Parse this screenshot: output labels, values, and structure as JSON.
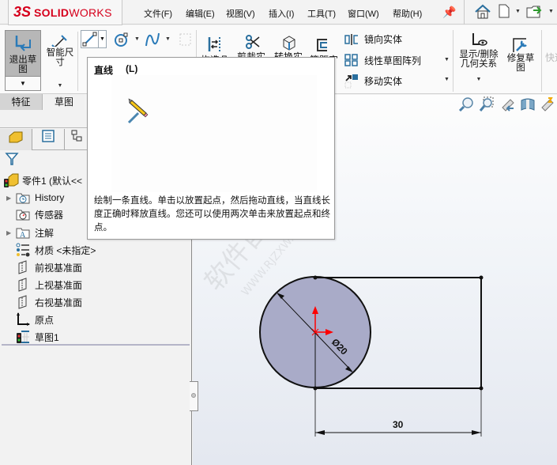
{
  "app": {
    "brand_prefix": "3S",
    "brand_bold": "SOLID",
    "brand_light": "WORKS"
  },
  "menu": [
    "文件(F)",
    "编辑(E)",
    "视图(V)",
    "插入(I)",
    "工具(T)",
    "窗口(W)",
    "帮助(H)"
  ],
  "title_icons": [
    "pin-icon",
    "home-icon",
    "new-document-icon",
    "open-document-icon"
  ],
  "ribbon": {
    "exit_sketch": "退出草图",
    "smart_dimension": "智能尺寸",
    "partial_labels": [
      "构造几",
      "剪裁实",
      "转换实",
      "等距实"
    ],
    "entity_tools": [
      "镜向实体",
      "线性草图阵列",
      "移动实体"
    ],
    "display_relations": "显示/删除几何关系",
    "repair_sketch": "修复草图",
    "quick_snaps_partial": "快速"
  },
  "command_tabs": {
    "feature": "特征",
    "sketch": "草图",
    "active": "草图"
  },
  "tooltip": {
    "title": "直线",
    "shortcut": "(L)",
    "description": "绘制一条直线。单击以放置起点，然后拖动直线，当直线长度正确时释放直线。您还可以使用两次单击来放置起点和终点。"
  },
  "feature_tree": {
    "root": "零件1  (默认<<",
    "items": [
      {
        "label": "History",
        "icon": "history-folder-icon",
        "expandable": true
      },
      {
        "label": "传感器",
        "icon": "sensor-folder-icon",
        "expandable": false
      },
      {
        "label": "注解",
        "icon": "annotation-folder-icon",
        "expandable": true
      },
      {
        "label": "材质 <未指定>",
        "icon": "material-icon",
        "expandable": false
      },
      {
        "label": "前视基准面",
        "icon": "plane-icon",
        "expandable": false
      },
      {
        "label": "上视基准面",
        "icon": "plane-icon",
        "expandable": false
      },
      {
        "label": "右视基准面",
        "icon": "plane-icon",
        "expandable": false
      },
      {
        "label": "原点",
        "icon": "origin-icon",
        "expandable": false
      },
      {
        "label": "草图1",
        "icon": "sketch-icon",
        "expandable": false
      }
    ]
  },
  "sketch": {
    "diameter_label": "Ø20",
    "length_label": "30",
    "circle_fill": "#a9abc8",
    "origin_color": "#ff0000"
  },
  "watermark": {
    "cn": "软件自学网",
    "url": "WWW.RJZXW.COM"
  }
}
